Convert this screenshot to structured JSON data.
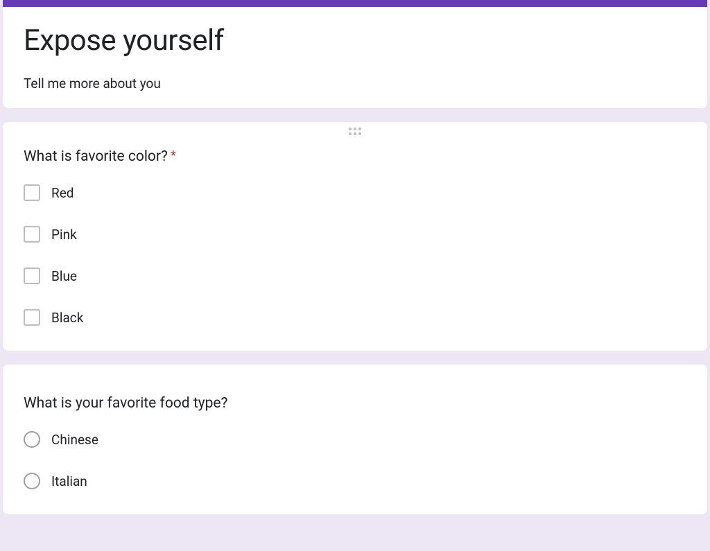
{
  "header": {
    "title": "Expose yourself",
    "description": "Tell me more about you"
  },
  "questions": [
    {
      "title": "What is favorite color?",
      "required": true,
      "required_star": "*",
      "type": "checkbox",
      "options": [
        "Red",
        "Pink",
        "Blue",
        "Black"
      ]
    },
    {
      "title": "What is your favorite food type?",
      "required": false,
      "type": "radio",
      "options": [
        "Chinese",
        "Italian"
      ]
    }
  ],
  "colors": {
    "accent": "#673ab7",
    "required": "#d93025",
    "background": "#ece6f5"
  }
}
